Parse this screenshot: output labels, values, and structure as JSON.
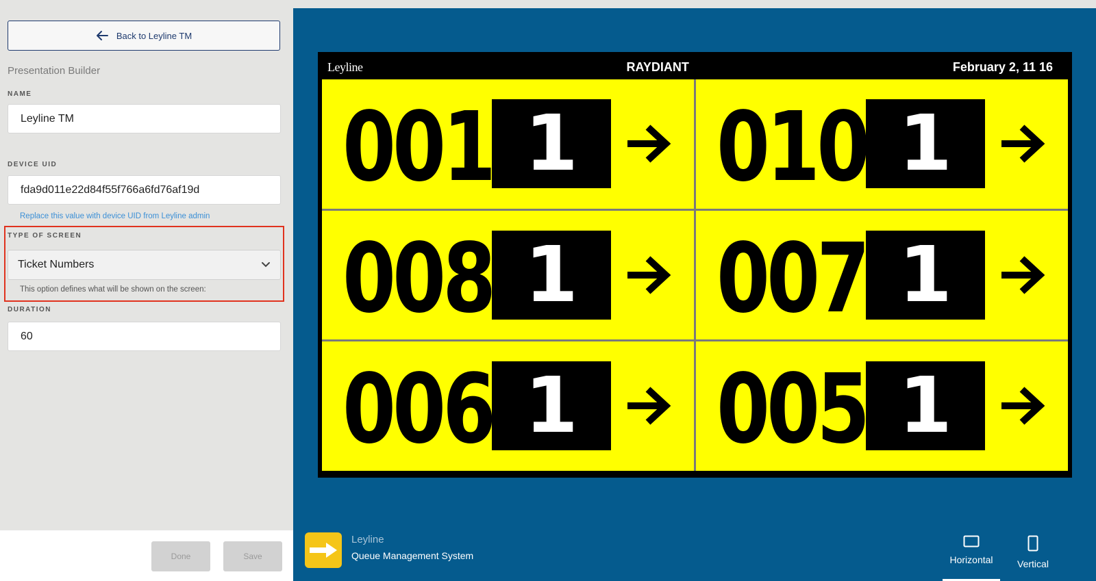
{
  "sidebar": {
    "back_label": "Back to Leyline TM",
    "section_title": "Presentation Builder",
    "name_label": "NAME",
    "name_value": "Leyline TM",
    "uid_label": "DEVICE UID",
    "uid_value": "fda9d011e22d84f55f766a6fd76af19d",
    "uid_helper": "Replace this value with device UID from Leyline admin",
    "screen_type_label": "TYPE OF SCREEN",
    "screen_type_value": "Ticket Numbers",
    "screen_type_helper": "This option defines what will be shown on the screen:",
    "duration_label": "DURATION",
    "duration_value": "60",
    "done_label": "Done",
    "save_label": "Save"
  },
  "preview": {
    "logo_text": "Leyline",
    "brand": "RAYDIANT",
    "date": "February 2, 11 16",
    "tickets": [
      {
        "number": "001",
        "counter": "1"
      },
      {
        "number": "010",
        "counter": "1"
      },
      {
        "number": "008",
        "counter": "1"
      },
      {
        "number": "007",
        "counter": "1"
      },
      {
        "number": "006",
        "counter": "1"
      },
      {
        "number": "005",
        "counter": "1"
      }
    ]
  },
  "footer": {
    "app_name": "Leyline",
    "app_subtitle": "Queue Management System",
    "horizontal_label": "Horizontal",
    "vertical_label": "Vertical",
    "active_orientation": "Horizontal"
  },
  "colors": {
    "preview_bg": "#055b8e",
    "cell_bg": "#ffff00",
    "accent_navy": "#1e3a6e",
    "highlight": "#e0321e",
    "app_icon_bg": "#f5c518"
  }
}
